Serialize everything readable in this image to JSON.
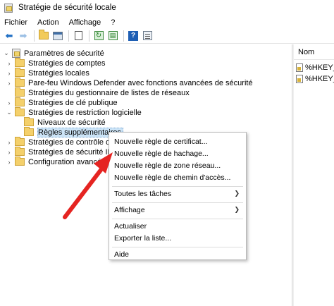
{
  "window": {
    "title": "Stratégie de sécurité locale"
  },
  "menubar": {
    "items": [
      "Fichier",
      "Action",
      "Affichage",
      "?"
    ]
  },
  "toolbar": {
    "buttons": [
      "back-arrow-icon",
      "forward-arrow-icon",
      "up-folder-icon",
      "show-hide-tree-icon",
      "properties-icon",
      "refresh-icon",
      "export-list-icon",
      "help-icon",
      "console-window-icon"
    ]
  },
  "tree": {
    "root": "Paramètres de sécurité",
    "items": [
      {
        "label": "Stratégies de comptes"
      },
      {
        "label": "Stratégies locales"
      },
      {
        "label": "Pare-feu Windows Defender avec fonctions avancées de sécurité"
      },
      {
        "label": "Stratégies du gestionnaire de listes de réseaux"
      },
      {
        "label": "Stratégies de clé publique"
      },
      {
        "label": "Stratégies de restriction logicielle"
      },
      {
        "label": "Niveaux de sécurité"
      },
      {
        "label": "Règles supplémentaires"
      },
      {
        "label": "Stratégies de contrôle d"
      },
      {
        "label": "Stratégies de sécurité IP"
      },
      {
        "label": "Configuration avancée c"
      }
    ]
  },
  "right_pane": {
    "column_header": "Nom",
    "rows": [
      "%HKEY_L",
      "%HKEY_L"
    ]
  },
  "context_menu": {
    "items": [
      "Nouvelle règle de certificat...",
      "Nouvelle règle de hachage...",
      "Nouvelle règle de zone réseau...",
      "Nouvelle règle de chemin d'accès...",
      "Toutes les tâches",
      "Affichage",
      "Actualiser",
      "Exporter la liste...",
      "Aide"
    ]
  },
  "annotation": {
    "arrow_color": "#e52421"
  }
}
